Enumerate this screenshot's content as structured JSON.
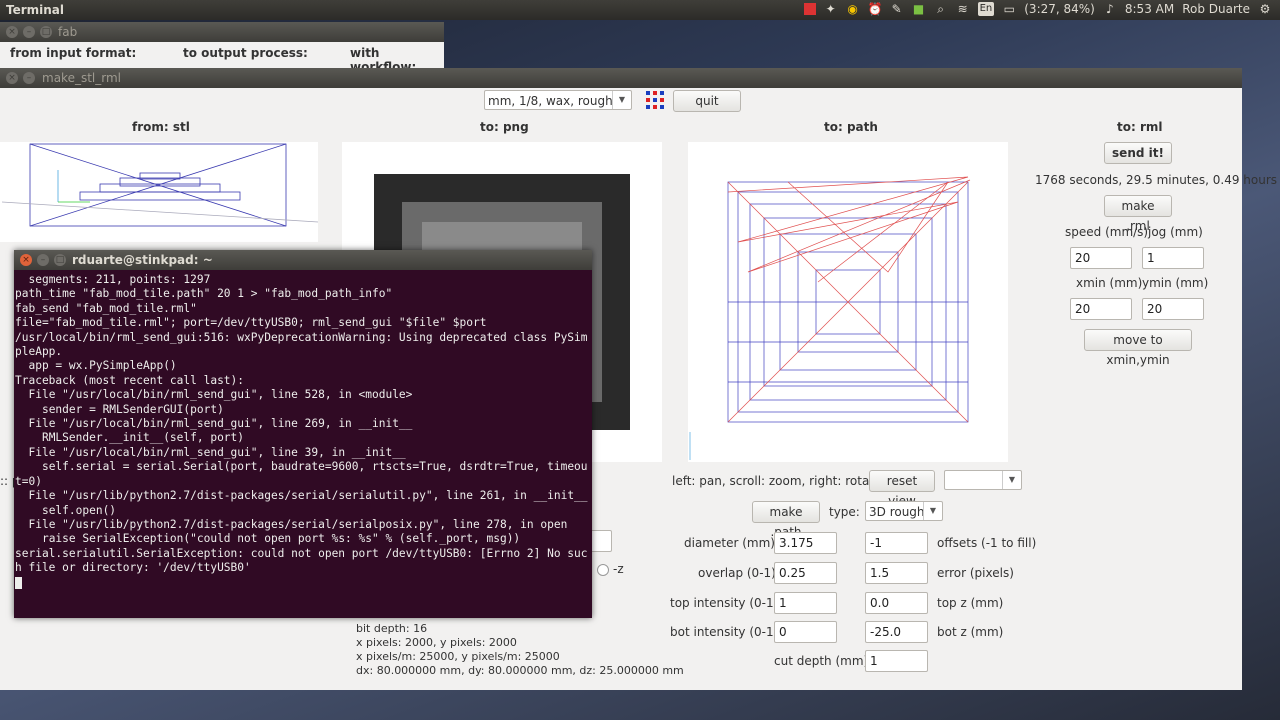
{
  "topbar": {
    "title": "Terminal",
    "battery": "(3:27, 84%)",
    "clock": "8:53 AM",
    "user": "Rob Duarte",
    "keyboard": "En"
  },
  "fab_window": {
    "title": "fab",
    "from_label": "from input format:",
    "to_label": "to output process:",
    "workflow_label": "with workflow:"
  },
  "stl_window": {
    "title": "make_stl_rml",
    "material_select": "mm, 1/8, wax, rough",
    "quit_label": "quit",
    "col_from": "from: stl",
    "col_png": "to: png",
    "col_path": "to: path",
    "col_rml": "to: rml",
    "send_label": "send it!",
    "time_text": "1768 seconds, 29.5 minutes, 0.49 hours",
    "make_rml_label": "make .rml",
    "speed_label": "speed (mm/s)",
    "jog_label": "jog (mm)",
    "speed_value": "20",
    "jog_value": "1",
    "xmin_label": "xmin (mm)",
    "ymin_label": "ymin (mm)",
    "xmin_value": "20",
    "ymin_value": "20",
    "move_label": "move to xmin,ymin",
    "view_hint": "left: pan, scroll: zoom, right: rotate",
    "reset_label": "reset view",
    "make_path_label": "make .path",
    "type_label": "type:",
    "type_value": "3D rough",
    "diameter_label": "diameter (mm)",
    "diameter_value": "3.175",
    "offsets_value": "-1",
    "offsets_label": "offsets (-1 to fill)",
    "overlap_label": "overlap (0-1)",
    "overlap_value": "0.25",
    "error_value": "1.5",
    "error_label": "error (pixels)",
    "topint_label": "top intensity (0-1)",
    "topint_value": "1",
    "topz_value": "0.0",
    "topz_label": "top z (mm)",
    "botint_label": "bot intensity (0-1)",
    "botint_value": "0",
    "botz_value": "-25.0",
    "botz_label": "bot z (mm)",
    "cut_label": "cut depth (mm)",
    "cut_value": "1",
    "minus_z": "-z",
    "info_bitdepth": "bit depth: 16",
    "info_pixels": "x pixels: 2000, y pixels: 2000",
    "info_ppm": "x pixels/m: 25000, y pixels/m: 25000",
    "info_dxdy": "dx: 80.000000 mm, dy: 80.000000 mm, dz: 25.000000 mm",
    "left_cut_text": ":: p"
  },
  "terminal": {
    "title": "rduarte@stinkpad: ~",
    "output": "  segments: 211, points: 1297\npath_time \"fab_mod_tile.path\" 20 1 > \"fab_mod_path_info\"\nfab_send \"fab_mod_tile.rml\"\nfile=\"fab_mod_tile.rml\"; port=/dev/ttyUSB0; rml_send_gui \"$file\" $port\n/usr/local/bin/rml_send_gui:516: wxPyDeprecationWarning: Using deprecated class PySimpleApp.\n  app = wx.PySimpleApp()\nTraceback (most recent call last):\n  File \"/usr/local/bin/rml_send_gui\", line 528, in <module>\n    sender = RMLSenderGUI(port)\n  File \"/usr/local/bin/rml_send_gui\", line 269, in __init__\n    RMLSender.__init__(self, port)\n  File \"/usr/local/bin/rml_send_gui\", line 39, in __init__\n    self.serial = serial.Serial(port, baudrate=9600, rtscts=True, dsrdtr=True, timeout=0)\n  File \"/usr/lib/python2.7/dist-packages/serial/serialutil.py\", line 261, in __init__\n    self.open()\n  File \"/usr/lib/python2.7/dist-packages/serial/serialposix.py\", line 278, in open\n    raise SerialException(\"could not open port %s: %s\" % (self._port, msg))\nserial.serialutil.SerialException: could not open port /dev/ttyUSB0: [Errno 2] No such file or directory: '/dev/ttyUSB0'\n"
  }
}
